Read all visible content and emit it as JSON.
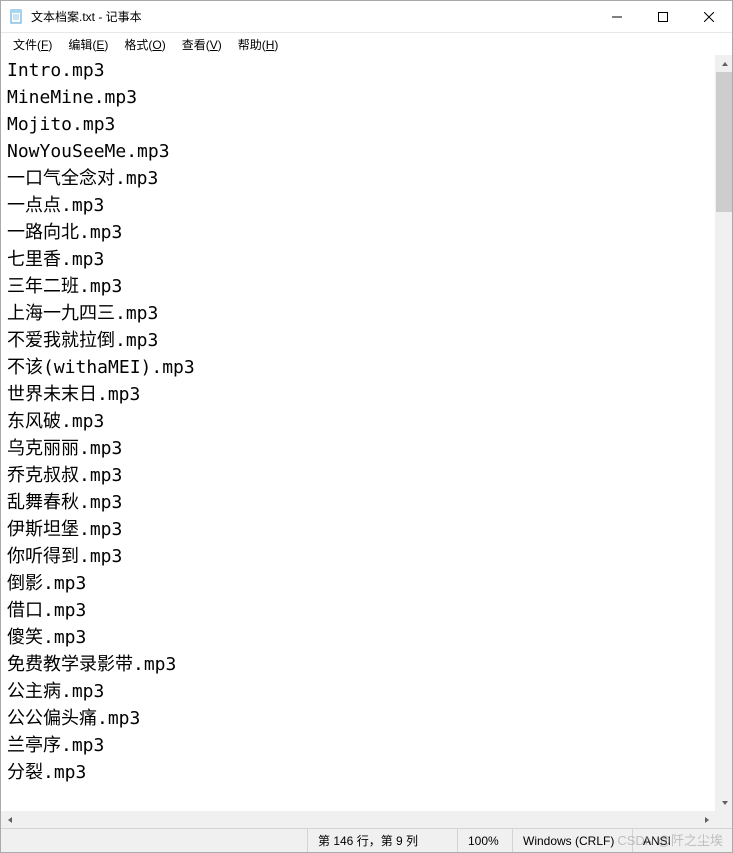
{
  "window": {
    "title": "文本档案.txt - 记事本"
  },
  "menu": {
    "file": "文件(F)",
    "edit": "编辑(E)",
    "format": "格式(O)",
    "view": "查看(V)",
    "help": "帮助(H)"
  },
  "content": {
    "lines": [
      "Intro.mp3",
      "MineMine.mp3",
      "Mojito.mp3",
      "NowYouSeeMe.mp3",
      "一口气全念对.mp3",
      "一点点.mp3",
      "一路向北.mp3",
      "七里香.mp3",
      "三年二班.mp3",
      "上海一九四三.mp3",
      "不爱我就拉倒.mp3",
      "不该(withaMEI).mp3",
      "世界未末日.mp3",
      "东风破.mp3",
      "乌克丽丽.mp3",
      "乔克叔叔.mp3",
      "乱舞春秋.mp3",
      "伊斯坦堡.mp3",
      "你听得到.mp3",
      "倒影.mp3",
      "借口.mp3",
      "傻笑.mp3",
      "免费教学录影带.mp3",
      "公主病.mp3",
      "公公偏头痛.mp3",
      "兰亭序.mp3",
      "分裂.mp3"
    ]
  },
  "status": {
    "position": "第 146 行，第 9 列",
    "zoom": "100%",
    "lineending": "Windows (CRLF)",
    "encoding": "ANSI"
  },
  "watermark": "CSDN @阡之尘埃"
}
